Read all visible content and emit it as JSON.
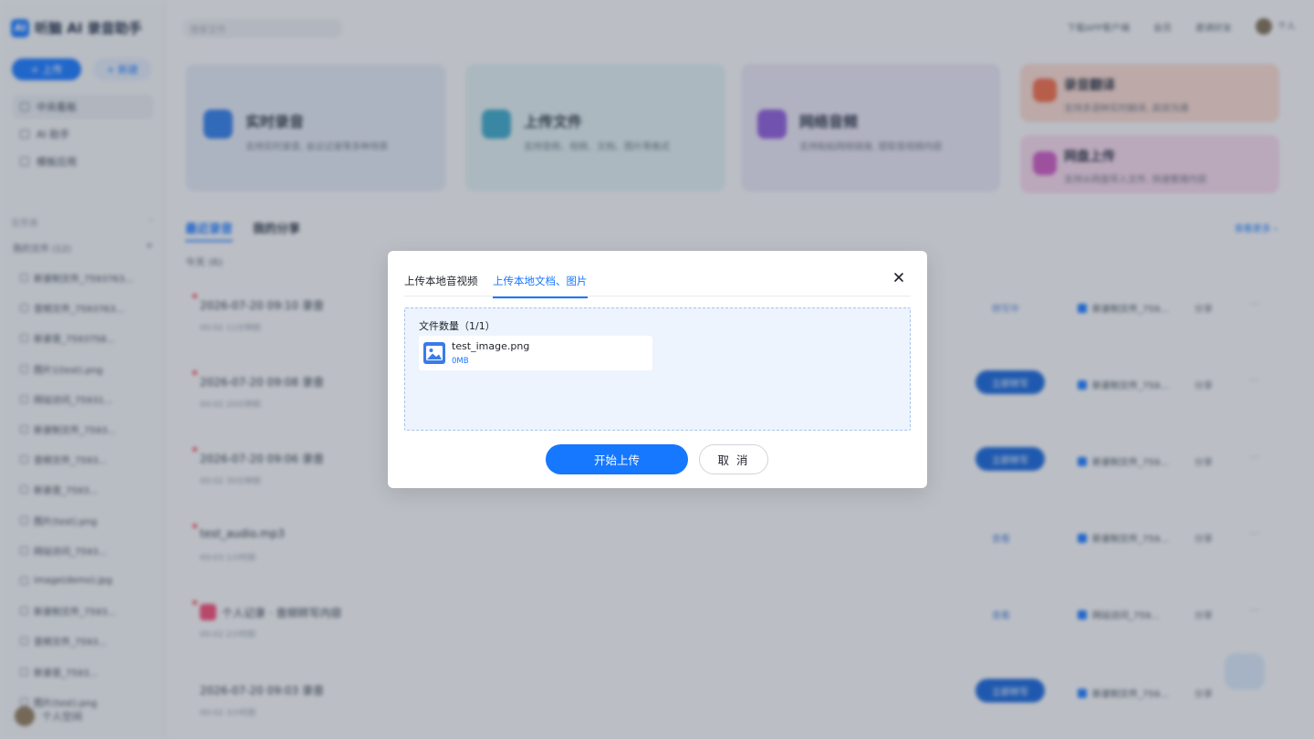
{
  "app": {
    "logo_mark": "AI",
    "title": "听脑 AI 录音助手"
  },
  "sidebar": {
    "primary_button": "+ 上传",
    "secondary_button": "+ 新建",
    "nav": [
      {
        "label": "中央看板",
        "icon": "home-icon"
      },
      {
        "label": "AI 助手",
        "icon": "assistant-icon"
      },
      {
        "label": "模板应用",
        "icon": "template-icon"
      }
    ],
    "section_label": "文件夹",
    "group_label": "我的文件",
    "group_count": "(12)",
    "files": [
      "新录制文件_7593763...",
      "音频文件_7593763...",
      "新录音_7593758...",
      "图片1(test).png",
      "网站访问_75931...",
      "新录制文件_7593...",
      "音频文件_7593...",
      "新录音_7593...",
      "图片(test).png",
      "网站访问_7593...",
      "image(demo).jpg",
      "新录制文件_7593...",
      "音频文件_7593...",
      "新录音_7593...",
      "图片(test).png"
    ],
    "user_name": "个人空间"
  },
  "topbar": {
    "search_placeholder": "搜索文件",
    "links": [
      "下载APP客户端",
      "会员",
      "邀请好友"
    ],
    "user": "个人"
  },
  "cards": [
    {
      "title": "实时录音",
      "desc": "支持实时录音, 会议记录等多种场景",
      "color": "#2f7be8"
    },
    {
      "title": "上传文件",
      "desc": "支持音频、视频、文档、图片等格式",
      "color": "#3aa5c8"
    },
    {
      "title": "网络音频",
      "desc": "支持粘贴网络链接, 提取音视频内容",
      "color": "#8a5ad8"
    },
    {
      "title": "录音翻译",
      "desc": "支持多语种实时翻译, 高效沟通",
      "color": "#ec6a4a"
    },
    {
      "title": "网盘上传",
      "desc": "支持从网盘导入文件, 快速整理内容",
      "color": "#c857c0"
    }
  ],
  "main": {
    "tabs": [
      "最近录音",
      "我的分享"
    ],
    "right_link": "查看更多 ›",
    "date_label": "今天 (6)",
    "rows": [
      {
        "title": "2026-07-20 09:10 录音",
        "meta": "00:02    11分钟前",
        "action": "转写中",
        "action_style": "plain",
        "folder": "新录制文件_759...",
        "share": "分享",
        "flag": true
      },
      {
        "title": "2026-07-20 09:08 录音",
        "meta": "00:02    20分钟前",
        "action": "立即转写",
        "action_style": "primary",
        "folder": "新录制文件_759...",
        "share": "分享",
        "flag": true
      },
      {
        "title": "2026-07-20 09:06 录音",
        "meta": "00:02    30分钟前",
        "action": "立即转写",
        "action_style": "primary",
        "folder": "新录制文件_759...",
        "share": "分享",
        "flag": true
      },
      {
        "title": "test_audio.mp3",
        "meta": "00:03    1小时前",
        "action": "查看",
        "action_style": "plain",
        "folder": "新录制文件_759...",
        "share": "分享",
        "flag": true
      },
      {
        "title": "个人记录 · 音频转写内容",
        "meta": "00:02    2小时前",
        "action": "查看",
        "action_style": "plain",
        "folder": "网站访问_759...",
        "share": "分享",
        "flag": true,
        "pink": true
      },
      {
        "title": "2026-07-20 09:03 录音",
        "meta": "00:02    3小时前",
        "action": "立即转写",
        "action_style": "primary",
        "folder": "新录制文件_759...",
        "share": "分享",
        "flag": false
      }
    ]
  },
  "modal": {
    "tabs": [
      "上传本地音视频",
      "上传本地文档、图片"
    ],
    "active_tab": 1,
    "count_label": "文件数量（1/1）",
    "file": {
      "name": "test_image.png",
      "size": "0MB",
      "icon": "image-file-icon"
    },
    "confirm": "开始上传",
    "cancel": "取 消",
    "close_icon": "close-icon",
    "accent": "#1677ff"
  }
}
